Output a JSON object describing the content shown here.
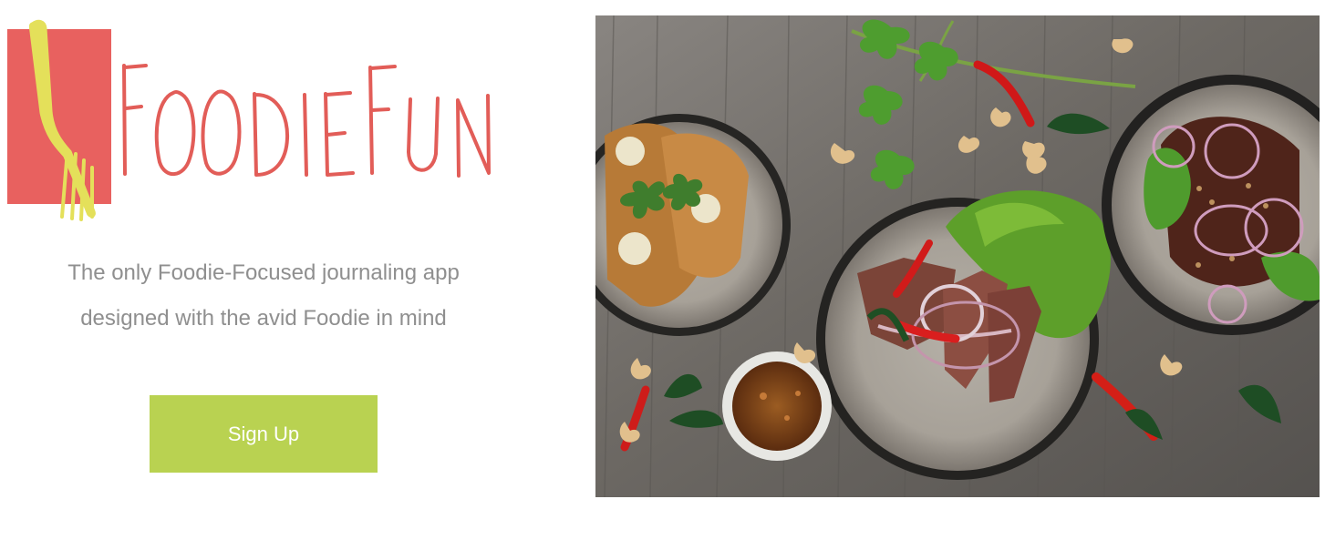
{
  "brand": {
    "name": "FoodieFun",
    "logo_icon": "fork-icon",
    "logo_block_color": "#e8615f",
    "fork_color": "#e4e05a"
  },
  "hero": {
    "tagline_line_1": "The only Foodie-Focused journaling app",
    "tagline_line_2": "designed with the avid Foodie in mind"
  },
  "actions": {
    "signup_label": "Sign Up",
    "signup_color": "#b9d251"
  },
  "photo": {
    "subject": "food-dishes-photo"
  }
}
